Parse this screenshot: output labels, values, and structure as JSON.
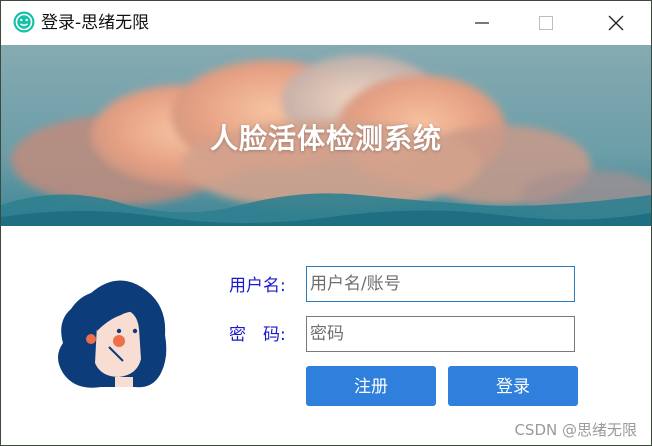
{
  "window": {
    "title": "登录-思绪无限",
    "icon": "smiley-app-icon",
    "controls": [
      "minimize-icon",
      "maximize-icon",
      "close-icon"
    ]
  },
  "banner": {
    "title": "人脸活体检测系统",
    "image": "sunset-clouds-sky"
  },
  "form": {
    "username_label": "用户名:",
    "username_placeholder": "用户名/账号",
    "username_value": "",
    "password_label": "密　码:",
    "password_placeholder": "密码",
    "password_value": "",
    "register_label": "注册",
    "login_label": "登录"
  },
  "avatar": {
    "icon": "cartoon-girl-avatar"
  },
  "watermark": "CSDN @思绪无限",
  "colors": {
    "accent_button": "#2f7fdc",
    "label_text": "#1a1acd",
    "active_border": "#2b7bbd"
  }
}
